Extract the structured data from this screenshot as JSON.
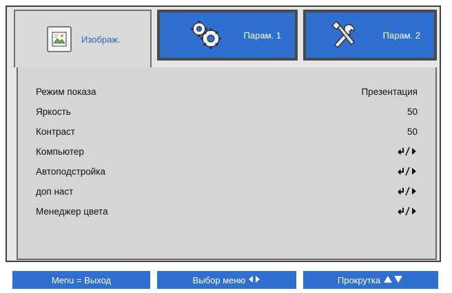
{
  "colors": {
    "accent": "#2f6fd0",
    "panel": "#d5d5d5",
    "active_tab_text": "#2c5fc4"
  },
  "tabs": [
    {
      "label": "Изображ.",
      "icon": "image-icon",
      "active": true
    },
    {
      "label": "Парам. 1",
      "icon": "gears-icon",
      "active": false
    },
    {
      "label": "Парам. 2",
      "icon": "tools-icon",
      "active": false
    }
  ],
  "menu": {
    "items": [
      {
        "label": "Режим показа",
        "value": "Презентация"
      },
      {
        "label": "Яркость",
        "value": "50"
      },
      {
        "label": "Контраст",
        "value": "50"
      },
      {
        "label": "Компьютер",
        "value_icon": "enter-right-icon"
      },
      {
        "label": "Автоподстройка",
        "value_icon": "enter-right-icon"
      },
      {
        "label": "доп наст",
        "value_icon": "enter-right-icon"
      },
      {
        "label": "Менеджер цвета",
        "value_icon": "enter-right-icon"
      }
    ]
  },
  "footer": {
    "exit": "Menu = Выход",
    "select": "Выбор меню",
    "select_icon": "left-right-icon",
    "scroll": "Прокрутка",
    "scroll_icon": "up-down-icon"
  }
}
